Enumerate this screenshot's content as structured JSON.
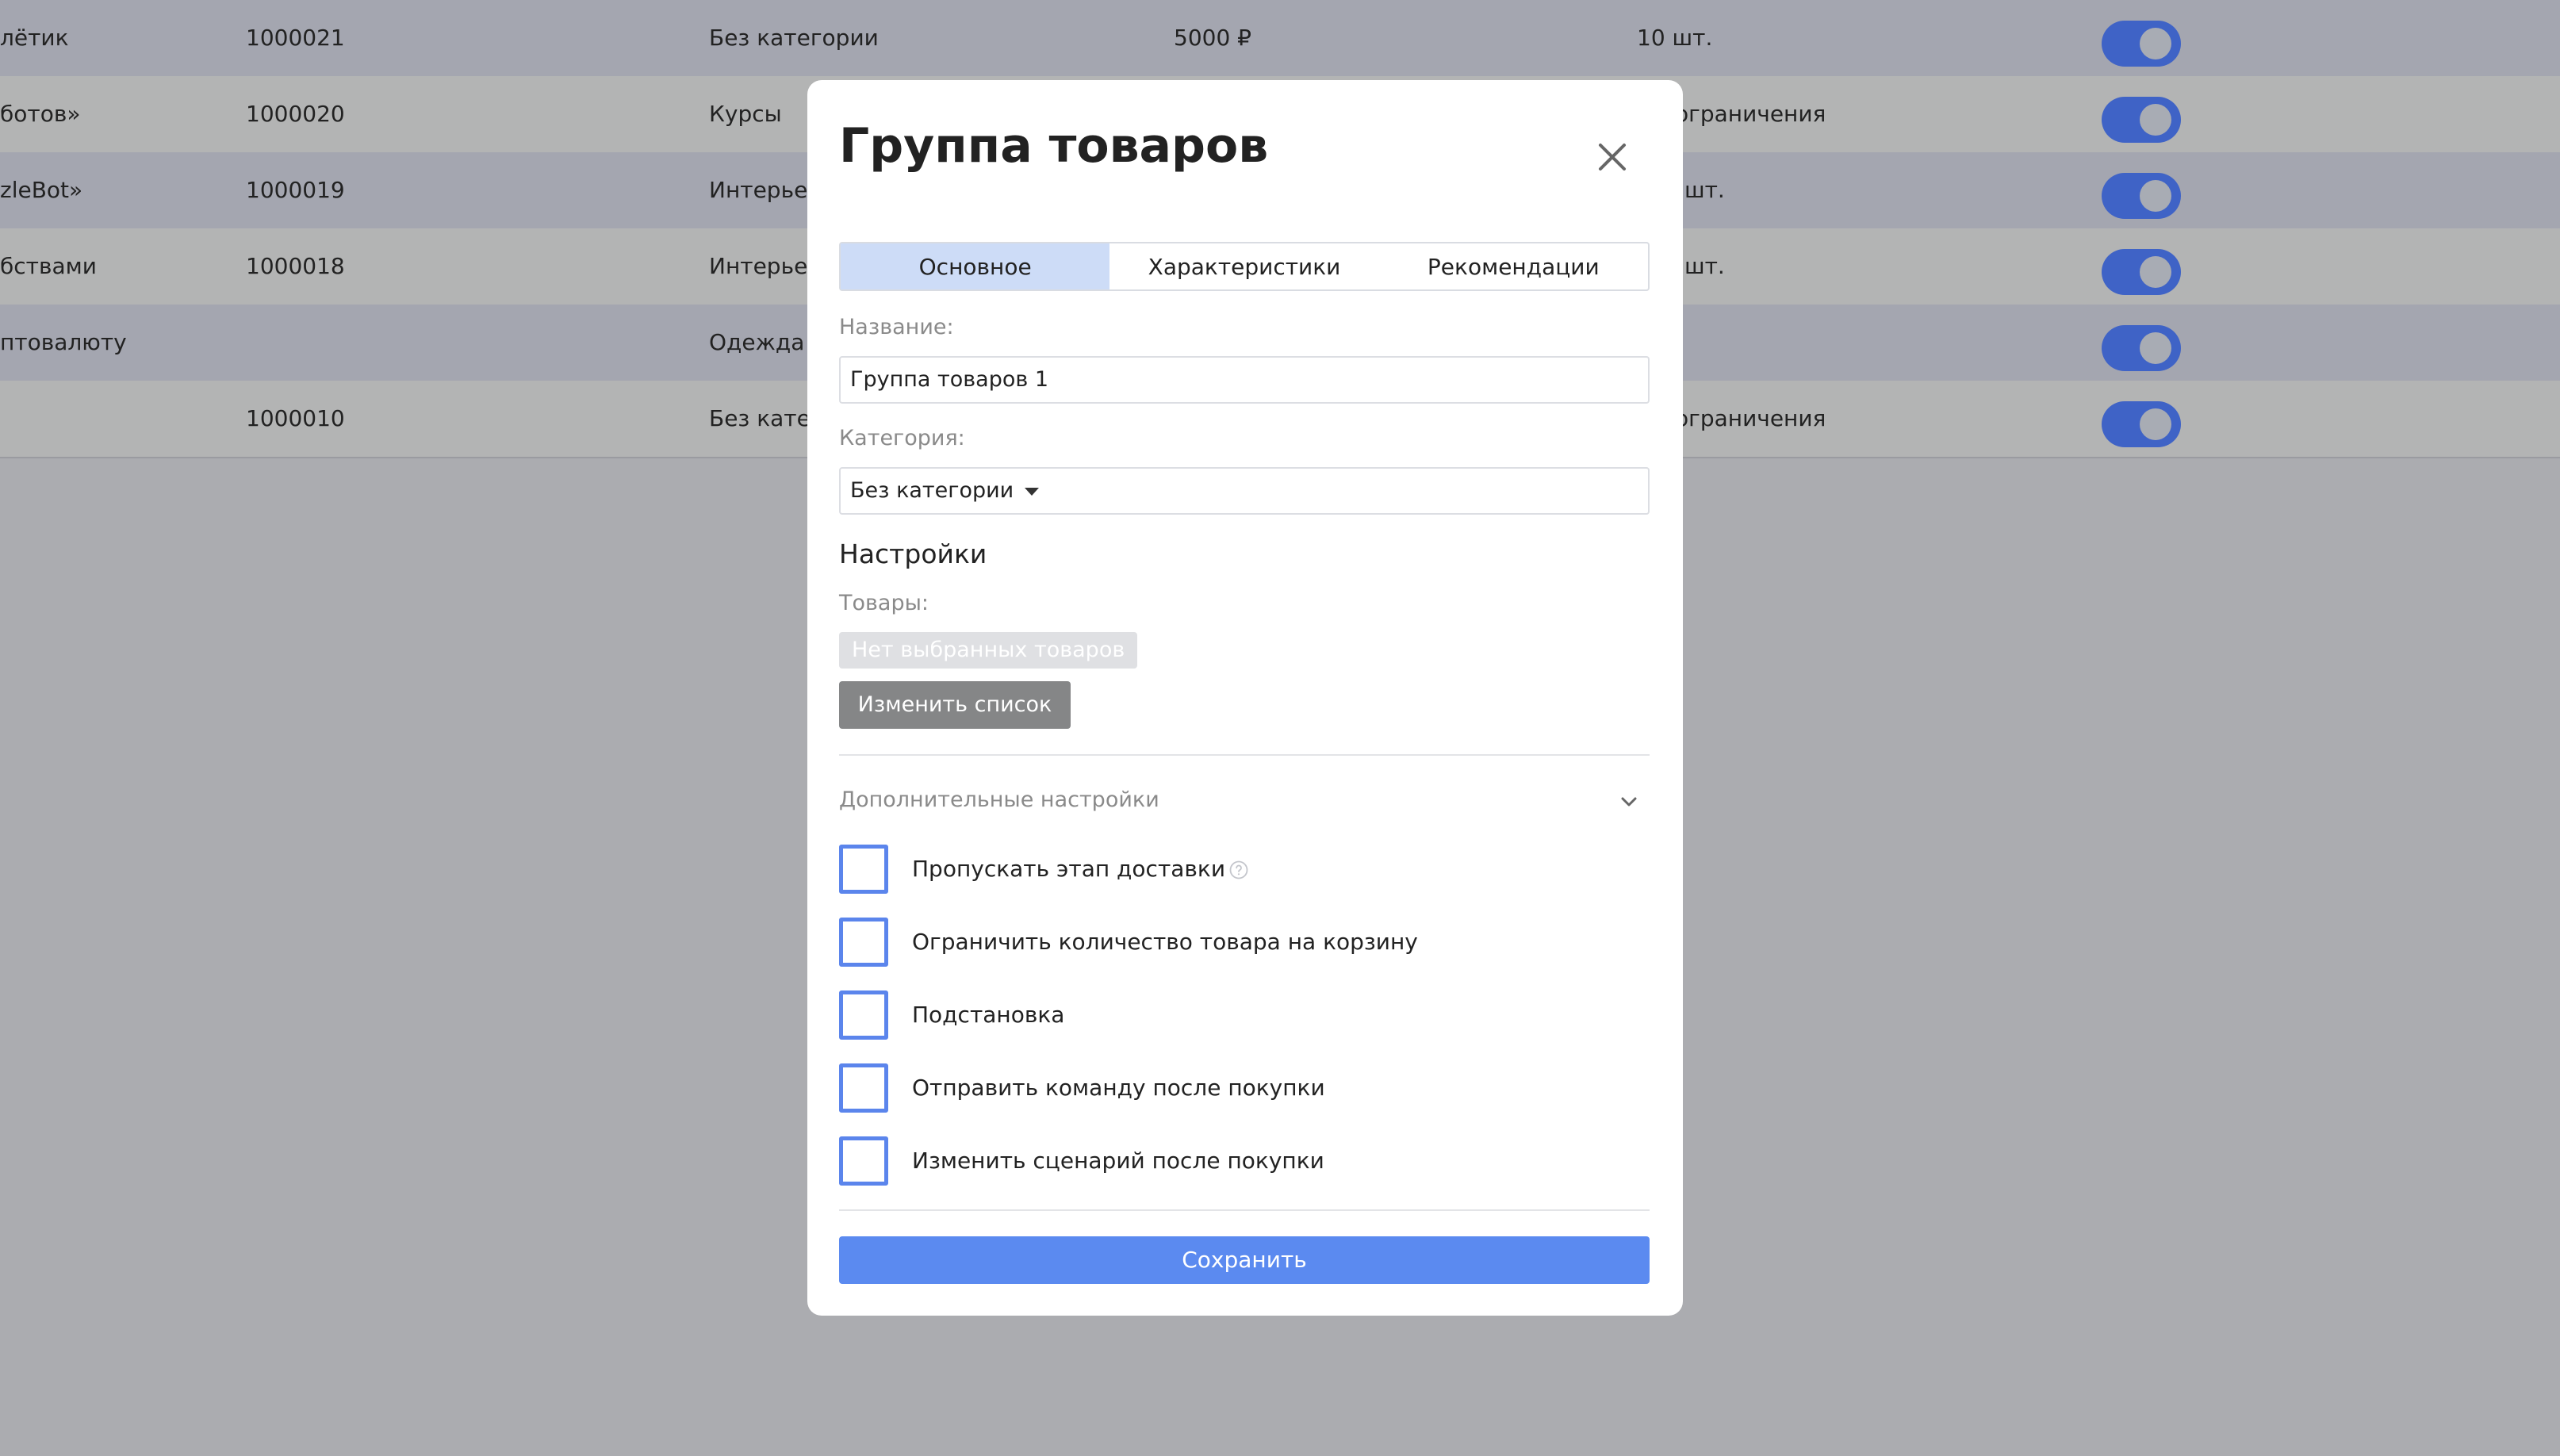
{
  "table": {
    "rows": [
      {
        "name": "лётик",
        "id": "1000021",
        "category": "Без категории",
        "price": "5000 ₽",
        "stock": "10 шт.",
        "enabled": true
      },
      {
        "name": "ботов»",
        "id": "1000020",
        "category": "Курсы",
        "price": "",
        "stock": "ограничения",
        "enabled": true
      },
      {
        "name": "zleBot»",
        "id": "1000019",
        "category": "Интерьер",
        "price": "",
        "stock": "шт.",
        "enabled": true
      },
      {
        "name": "бствами",
        "id": "1000018",
        "category": "Интерьер",
        "price": "",
        "stock": "шт.",
        "enabled": true
      },
      {
        "name": "птовалюту",
        "id": "",
        "category": "Одежда",
        "price": "",
        "stock": "",
        "enabled": true
      },
      {
        "name": "",
        "id": "1000010",
        "category": "Без катег",
        "price": "",
        "stock": "ограничения",
        "enabled": true
      }
    ]
  },
  "modal": {
    "title": "Группа товаров",
    "tabs": [
      "Основное",
      "Характеристики",
      "Рекомендации"
    ],
    "active_tab": "Основное",
    "name_label": "Название:",
    "name_value": "Группа товаров 1",
    "category_label": "Категория:",
    "category_value": "Без категории",
    "settings_title": "Настройки",
    "products_label": "Товары:",
    "no_products": "Нет выбранных товаров",
    "edit_list_button": "Изменить список",
    "advanced_title": "Дополнительные настройки",
    "options": [
      {
        "label": "Пропускать этап доставки",
        "checked": false,
        "help": true
      },
      {
        "label": "Ограничить количество товара на корзину",
        "checked": false
      },
      {
        "label": "Подстановка",
        "checked": false
      },
      {
        "label": "Отправить команду после покупки",
        "checked": false
      },
      {
        "label": "Изменить сценарий после покупки",
        "checked": false
      }
    ],
    "save_button": "Сохранить"
  },
  "colors": {
    "accent": "#5b8af0",
    "toggle_on": "#3f63c6",
    "tab_active": "#cddcf7",
    "overlay": "#abacb0"
  }
}
